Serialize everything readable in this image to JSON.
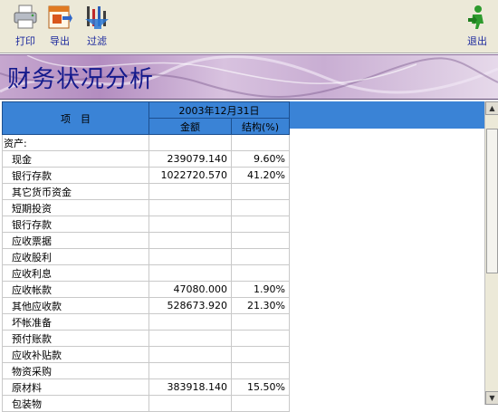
{
  "toolbar": {
    "print": {
      "label": "打印",
      "icon": "printer-icon"
    },
    "export": {
      "label": "导出",
      "icon": "export-icon"
    },
    "filter": {
      "label": "过滤",
      "icon": "filter-icon"
    },
    "exit": {
      "label": "退出",
      "icon": "exit-icon"
    }
  },
  "banner": {
    "title": "财务状况分析"
  },
  "grid": {
    "col_item": "项　目",
    "date_header": "2003年12月31日",
    "col_amount": "金额",
    "col_structure": "结构(%)",
    "rows": [
      {
        "name": "资产:",
        "amount": "",
        "structure": "",
        "category": true
      },
      {
        "name": "现金",
        "amount": "239079.140",
        "structure": "9.60%"
      },
      {
        "name": "银行存款",
        "amount": "1022720.570",
        "structure": "41.20%"
      },
      {
        "name": "其它货币资金",
        "amount": "",
        "structure": ""
      },
      {
        "name": "短期投资",
        "amount": "",
        "structure": ""
      },
      {
        "name": "银行存款",
        "amount": "",
        "structure": ""
      },
      {
        "name": "应收票据",
        "amount": "",
        "structure": ""
      },
      {
        "name": "应收股利",
        "amount": "",
        "structure": ""
      },
      {
        "name": "应收利息",
        "amount": "",
        "structure": ""
      },
      {
        "name": "应收帐款",
        "amount": "47080.000",
        "structure": "1.90%"
      },
      {
        "name": "其他应收款",
        "amount": "528673.920",
        "structure": "21.30%"
      },
      {
        "name": "坏帐准备",
        "amount": "",
        "structure": ""
      },
      {
        "name": "预付账款",
        "amount": "",
        "structure": ""
      },
      {
        "name": "应收补贴款",
        "amount": "",
        "structure": ""
      },
      {
        "name": "物资采购",
        "amount": "",
        "structure": ""
      },
      {
        "name": "原材料",
        "amount": "383918.140",
        "structure": "15.50%"
      },
      {
        "name": "包装物",
        "amount": "",
        "structure": ""
      }
    ]
  },
  "colors": {
    "header_blue": "#3a83d6",
    "toolbar_bg": "#ece9d8",
    "title_color": "#141a8c"
  }
}
